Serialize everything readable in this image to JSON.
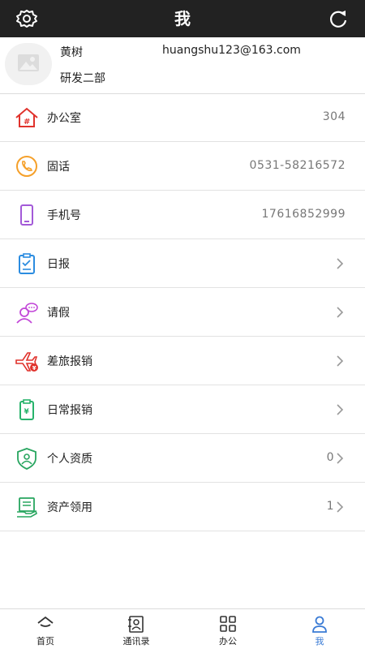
{
  "header": {
    "title": "我",
    "left_icon": "settings-icon",
    "right_icon": "refresh-icon"
  },
  "profile": {
    "name": "黄树",
    "department": "研发二部",
    "email": "huangshu123@163.com"
  },
  "menu": [
    {
      "label": "办公室",
      "value": "304",
      "icon": "office-icon",
      "color": "#e0322c"
    },
    {
      "label": "固话",
      "value": "0531-58216572",
      "icon": "phone-icon",
      "color": "#f5a02a"
    },
    {
      "label": "手机号",
      "value": "17616852999",
      "icon": "mobile-icon",
      "color": "#a35ad8"
    },
    {
      "label": "日报",
      "value": "",
      "icon": "daily-report-icon",
      "color": "#2b8ce0"
    },
    {
      "label": "请假",
      "value": "",
      "icon": "leave-icon",
      "color": "#c247d8"
    },
    {
      "label": "差旅报销",
      "value": "",
      "icon": "travel-expense-icon",
      "color": "#e0322c"
    },
    {
      "label": "日常报销",
      "value": "",
      "icon": "daily-expense-icon",
      "color": "#27b36b"
    },
    {
      "label": "个人资质",
      "value": "0",
      "icon": "qualification-icon",
      "color": "#27a55f"
    },
    {
      "label": "资产领用",
      "value": "1",
      "icon": "asset-icon",
      "color": "#27a55f"
    }
  ],
  "tabs": [
    {
      "label": "首页",
      "icon": "home-icon"
    },
    {
      "label": "通讯录",
      "icon": "contacts-icon"
    },
    {
      "label": "办公",
      "icon": "office-apps-icon"
    },
    {
      "label": "我",
      "icon": "profile-icon",
      "active": true
    }
  ],
  "colors": {
    "accent": "#3a7bd5",
    "header_bg": "#222222"
  }
}
